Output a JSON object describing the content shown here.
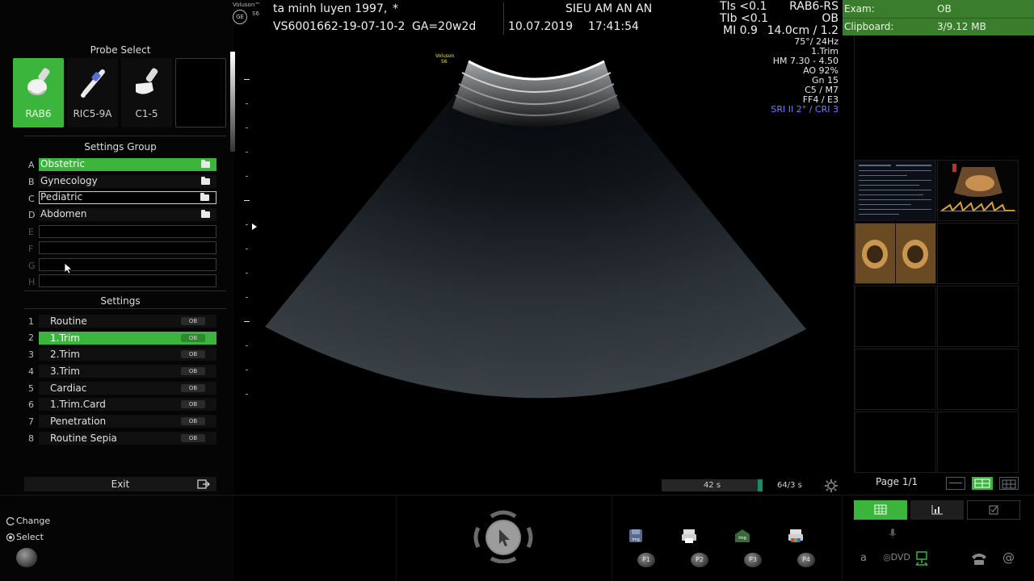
{
  "probe_select": {
    "title": "Probe Select",
    "probes": [
      {
        "label": "RAB6",
        "active": true,
        "icon": "convex-volume-probe-icon"
      },
      {
        "label": "RIC5-9A",
        "active": false,
        "icon": "endocavity-probe-icon"
      },
      {
        "label": "C1-5",
        "active": false,
        "icon": "convex-probe-icon"
      },
      {
        "label": "",
        "active": false,
        "icon": ""
      }
    ]
  },
  "settings_group": {
    "title": "Settings Group",
    "rows": [
      {
        "letter": "A",
        "label": "Obstetric"
      },
      {
        "letter": "B",
        "label": "Gynecology"
      },
      {
        "letter": "C",
        "label": "Pediatric"
      },
      {
        "letter": "D",
        "label": "Abdomen"
      },
      {
        "letter": "E",
        "label": ""
      },
      {
        "letter": "F",
        "label": ""
      },
      {
        "letter": "G",
        "label": ""
      },
      {
        "letter": "H",
        "label": ""
      }
    ]
  },
  "settings": {
    "title": "Settings",
    "badge": "OB",
    "rows": [
      {
        "num": "1",
        "label": "Routine"
      },
      {
        "num": "2",
        "label": "1.Trim"
      },
      {
        "num": "3",
        "label": "2.Trim"
      },
      {
        "num": "4",
        "label": "3.Trim"
      },
      {
        "num": "5",
        "label": "Cardiac"
      },
      {
        "num": "6",
        "label": "1.Trim.Card"
      },
      {
        "num": "7",
        "label": "Penetration"
      },
      {
        "num": "8",
        "label": "Routine Sepia"
      }
    ]
  },
  "exit_label": "Exit",
  "bottom_left": {
    "change": "Change",
    "select": "Select"
  },
  "header": {
    "brand_line1": "Voluson™",
    "brand_line2": "S6",
    "brand_logo": "GE",
    "patient": "ta minh luyen 1997,",
    "patient_mark": "*",
    "patient_id": "VS6001662-19-07-10-2",
    "ga": "GA=20w2d",
    "institution": "SIEU AM AN AN",
    "date": "10.07.2019",
    "time": "17:41:54",
    "tis": "TIs <0.1",
    "tib": "TIb <0.1",
    "mi": "MI  0.9",
    "probe": "RAB6-RS",
    "app": "OB",
    "depth": "14.0cm / 1.2"
  },
  "image_params": {
    "lines": [
      "75°/ 24Hz",
      "1.Trim",
      "HM  7.30 - 4.50",
      "AO 92%",
      "Gn  15",
      "C5 / M7",
      "FF4 / E3"
    ],
    "sri": "SRI II 2° / CRI 3",
    "sri_color": "#7a7aff"
  },
  "image_logo": {
    "line1": "Voluson",
    "line2": "S6"
  },
  "right_panel": {
    "exam_label": "Exam:",
    "exam_value": "OB",
    "clipboard_label": "Clipboard:",
    "clipboard_value": "3/9.12 MB",
    "page": "Page 1/1"
  },
  "cine": {
    "time": "42 s",
    "frames": "64/3 s"
  },
  "presets": {
    "p1": "P1",
    "p2": "P2",
    "p3": "P3",
    "p4": "P4",
    "save_icon_label": "Img",
    "print_icon_label": "Img"
  },
  "bottom_right": {
    "a_label": "a",
    "dvd_label": "DVD",
    "at_label": "@"
  },
  "colors": {
    "accent_green": "#3bb53b",
    "header_green": "#3a7d2c"
  }
}
